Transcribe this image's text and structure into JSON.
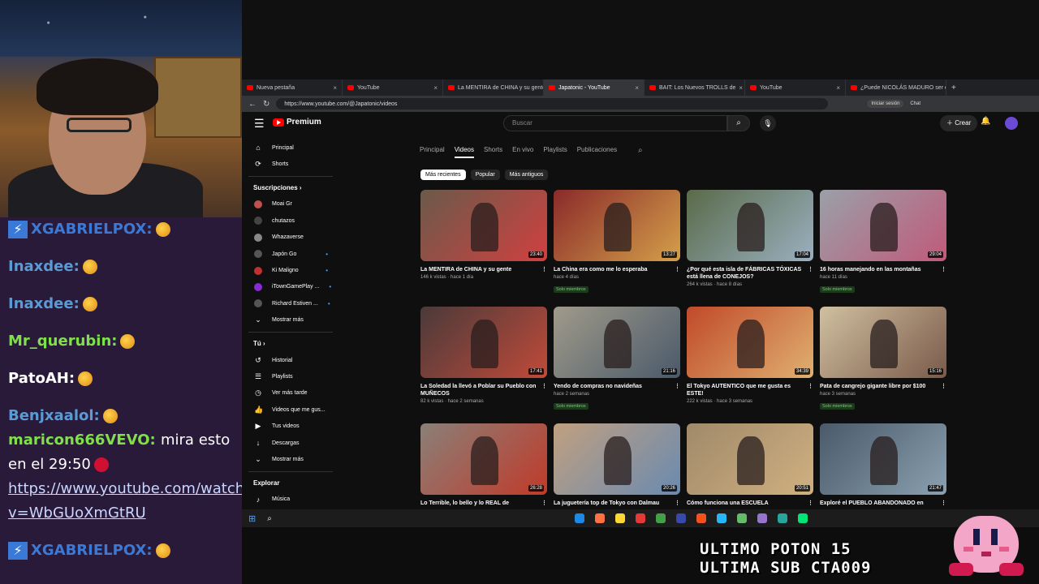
{
  "chat": {
    "lines": [
      {
        "user": "XGABRIELPOX:",
        "color": "#3a7ad6"
      },
      {
        "user": "Inaxdee:",
        "color": "#5b9bd5"
      },
      {
        "user": "Inaxdee:",
        "color": "#5b9bd5"
      },
      {
        "user": "Mr_querubin:",
        "color": "#7fe04a"
      },
      {
        "user": "PatoAH:",
        "color": "#ffffff"
      },
      {
        "user": "Benjxaalol:",
        "color": "#5b9bd5"
      },
      {
        "user": "maricon666VEVO:",
        "color": "#7fe04a",
        "msg": "mira esto en el 29:50"
      },
      {
        "link": "https://www.youtube.com/watch?v=WbGUoXmGtRU"
      },
      {
        "user": "XGABRIELPOX:",
        "color": "#3a7ad6"
      }
    ]
  },
  "browser": {
    "tabs": [
      {
        "label": "Nueva pestaña",
        "active": false
      },
      {
        "label": "YouTube",
        "active": false
      },
      {
        "label": "La MENTIRA de CHINA y su gente",
        "active": false
      },
      {
        "label": "Japatonic - YouTube",
        "active": true
      },
      {
        "label": "BAIT: Los Nuevos TROLLS de",
        "active": false
      },
      {
        "label": "YouTube",
        "active": false
      },
      {
        "label": "¿Puede NICOLÁS MADURO ser el",
        "active": false
      }
    ],
    "url": "https://www.youtube.com/@Japatonic/videos",
    "signin": "Iniciar sesión",
    "chat": "Chat"
  },
  "yt": {
    "logo": "Premium",
    "search_placeholder": "Buscar",
    "create": "Crear",
    "sidebar": {
      "top": [
        {
          "label": "Principal",
          "icon": "⌂"
        },
        {
          "label": "Shorts",
          "icon": "⟳"
        }
      ],
      "subs_heading": "Suscripciones  ›",
      "subs": [
        {
          "label": "Moai Gr",
          "color": "#c0504d",
          "dot": false
        },
        {
          "label": "chutazos",
          "color": "#444444",
          "dot": false
        },
        {
          "label": "Whazaverse",
          "color": "#888888",
          "dot": false
        },
        {
          "label": "Japón Go",
          "color": "#555555",
          "dot": true
        },
        {
          "label": "Ki Maligno",
          "color": "#c03030",
          "dot": true
        },
        {
          "label": "iTownGamePlay ...",
          "color": "#8a2ad6",
          "dot": true
        },
        {
          "label": "Richard Estiven ...",
          "color": "#555555",
          "dot": true
        }
      ],
      "show_more": "Mostrar más",
      "you_heading": "Tú  ›",
      "you": [
        {
          "label": "Historial",
          "icon": "↺"
        },
        {
          "label": "Playlists",
          "icon": "☰"
        },
        {
          "label": "Ver más tarde",
          "icon": "◷"
        },
        {
          "label": "Videos que me gus...",
          "icon": "👍"
        },
        {
          "label": "Tus videos",
          "icon": "▶"
        },
        {
          "label": "Descargas",
          "icon": "↓"
        }
      ],
      "show_more2": "Mostrar más",
      "explore_heading": "Explorar",
      "music": "Música"
    },
    "channel_tabs": [
      "Principal",
      "Videos",
      "Shorts",
      "En vivo",
      "Playlists",
      "Publicaciones"
    ],
    "chips": [
      "Más recientes",
      "Popular",
      "Más antiguos"
    ],
    "videos": [
      {
        "title": "La MENTIRA de CHINA y su gente",
        "meta": "146 k vistas · hace 1 día",
        "dur": "23:40",
        "members": "",
        "c1": "#6a5a4a",
        "c2": "#d04040"
      },
      {
        "title": "La China era como me lo esperaba",
        "meta": "hace 4 días",
        "dur": "13:27",
        "members": "Solo miembros",
        "c1": "#8a2a2a",
        "c2": "#d4a04a"
      },
      {
        "title": "¿Por qué esta isla de FÁBRICAS TÓXICAS está llena de CONEJOS?",
        "meta": "264 k vistas · hace 8 días",
        "dur": "17:04",
        "members": "",
        "c1": "#5a6a4a",
        "c2": "#9ab0c0"
      },
      {
        "title": "16 horas manejando en las montañas",
        "meta": "hace 11 días",
        "dur": "29:04",
        "members": "Solo miembros",
        "c1": "#9aa0a8",
        "c2": "#c05a7a"
      },
      {
        "title": "La Soledad la llevó a Poblar su Pueblo con MUÑECOS",
        "meta": "82 k vistas · hace 2 semanas",
        "dur": "17:41",
        "members": "",
        "c1": "#4a3a3a",
        "c2": "#c04a3a"
      },
      {
        "title": "Yendo de compras no navideñas",
        "meta": "hace 2 semanas",
        "dur": "21:16",
        "members": "Solo miembros",
        "c1": "#a09a8a",
        "c2": "#4a5a6a"
      },
      {
        "title": "El Tokyo AUTENTICO que me gusta es ESTE!",
        "meta": "222 k vistas · hace 3 semanas",
        "dur": "34:39",
        "members": "",
        "c1": "#c04a2a",
        "c2": "#e0b070"
      },
      {
        "title": "Pata de cangrejo gigante libre por $100",
        "meta": "hace 3 semanas",
        "dur": "15:16",
        "members": "Solo miembros",
        "c1": "#d0c0a0",
        "c2": "#7a5a4a"
      },
      {
        "title": "Lo Terrible, lo bello y lo REAL de",
        "meta": "",
        "dur": "26:28",
        "members": "",
        "c1": "#8a8078",
        "c2": "#c03a2a"
      },
      {
        "title": "La juguetería top de Tokyo con Dalmau",
        "meta": "",
        "dur": "20:26",
        "members": "",
        "c1": "#c0a080",
        "c2": "#6a8ab0"
      },
      {
        "title": "Cómo funciona una ESCUELA",
        "meta": "",
        "dur": "20:51",
        "members": "",
        "c1": "#a08a6a",
        "c2": "#d0b080"
      },
      {
        "title": "Exploré el PUEBLO ABANDONADO en",
        "meta": "",
        "dur": "21:47",
        "members": "",
        "c1": "#4a5a6a",
        "c2": "#8aa0b0"
      }
    ]
  },
  "overlay": {
    "line1": "ULTIMO POTON 15",
    "line2": "ULTIMA SUB CTA009"
  },
  "taskbar_icons": [
    "#1e88e5",
    "#ff7043",
    "#fdd835",
    "#e53935",
    "#43a047",
    "#3949ab",
    "#f4511e",
    "#29b6f6",
    "#66bb6a",
    "#9575cd",
    "#26a69a",
    "#00e676"
  ]
}
